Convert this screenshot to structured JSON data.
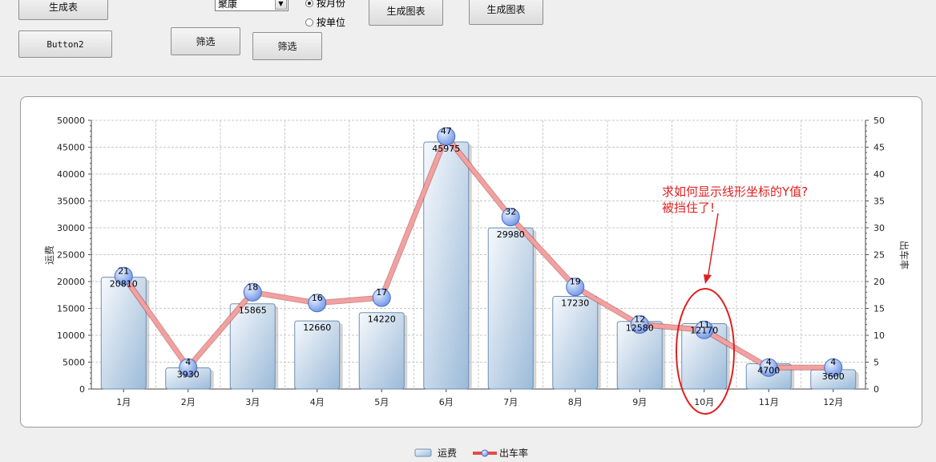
{
  "controls": {
    "btn_generate_table": "生成表",
    "btn_button2": "Button2",
    "select_value": "聚康",
    "radio_month": "按月份",
    "radio_unit": "按单位",
    "btn_filter_1": "筛选",
    "btn_filter_2": "筛选",
    "btn_chart_1": "生成图表",
    "btn_chart_2": "生成图表"
  },
  "annotation": {
    "line1": "求如何显示线形坐标的Y值?",
    "line2": "被挡住了!"
  },
  "colors": {
    "bar_top": "#f4f7fb",
    "bar_bottom": "#9dbbdb",
    "line": "#e84a4a",
    "marker": "#8fb0f0",
    "annotation": "#e02020"
  },
  "chart_data": {
    "type": "bar",
    "categories": [
      "1月",
      "2月",
      "3月",
      "4月",
      "5月",
      "6月",
      "7月",
      "8月",
      "9月",
      "10月",
      "11月",
      "12月"
    ],
    "ylabel": "运费",
    "y2label": "出车率",
    "ylim": [
      0,
      50000
    ],
    "y2lim": [
      0,
      50
    ],
    "yticks": [
      0,
      5000,
      10000,
      15000,
      20000,
      25000,
      30000,
      35000,
      40000,
      45000,
      50000
    ],
    "y2ticks": [
      0,
      5,
      10,
      15,
      20,
      25,
      30,
      35,
      40,
      45,
      50
    ],
    "grid": true,
    "legend_position": "bottom",
    "series": [
      {
        "name": "运费",
        "type": "bar",
        "axis": "left",
        "values": [
          20810,
          3930,
          15865,
          12660,
          14220,
          45975,
          29980,
          17230,
          12580,
          12170,
          4700,
          3600
        ]
      },
      {
        "name": "出车率",
        "type": "line",
        "axis": "right",
        "values": [
          21,
          4,
          18,
          16,
          17,
          47,
          32,
          19,
          12,
          11,
          4,
          4
        ]
      }
    ]
  }
}
